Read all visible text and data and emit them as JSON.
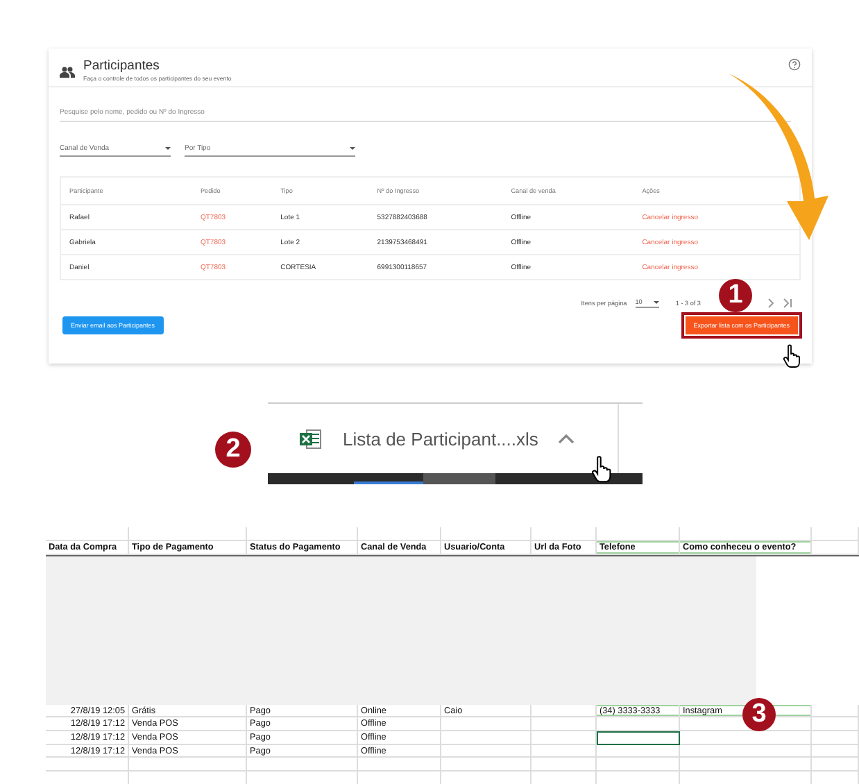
{
  "card": {
    "title": "Participantes",
    "subtitle": "Faça o controle de todos os participantes do seu evento",
    "search": {
      "placeholder": "Pesquise pelo nome, pedido ou Nº do Ingresso"
    },
    "filters": [
      {
        "placeholder": "Canal de Venda"
      },
      {
        "placeholder": "Por Tipo"
      }
    ],
    "table": {
      "columns": [
        "Participante",
        "Pedido",
        "Tipo",
        "Nº do Ingresso",
        "Canal de venda",
        "Ações"
      ],
      "rows": [
        [
          "Rafael",
          "QT7803",
          "Lote 1",
          "5327882403688",
          "Offline",
          "Cancelar ingresso"
        ],
        [
          "Gabriela",
          "QT7803",
          "Lote 2",
          "2139753468491",
          "Offline",
          "Cancelar ingresso"
        ],
        [
          "Daniel",
          "QT7803",
          "CORTESIA",
          "6991300118657",
          "Offline",
          "Cancelar ingresso"
        ]
      ]
    },
    "pagination": {
      "items_label": "Itens per página",
      "per_page": "10",
      "range": "1 - 3 of 3"
    },
    "email_button": "Enviar email aos Participantes",
    "export_button": "Exportar lista com os Participantes"
  },
  "steps": [
    "1",
    "2",
    "3"
  ],
  "download": {
    "filename": "Lista de Participant....xls"
  },
  "sheet": {
    "columns": [
      {
        "label": "Data da Compra",
        "highlighted": false
      },
      {
        "label": "Tipo de Pagamento",
        "highlighted": false
      },
      {
        "label": "Status do Pagamento",
        "highlighted": false
      },
      {
        "label": "Canal de Venda",
        "highlighted": false
      },
      {
        "label": "Usuario/Conta",
        "highlighted": false
      },
      {
        "label": "Url da Foto",
        "highlighted": false
      },
      {
        "label": "Telefone",
        "highlighted": true
      },
      {
        "label": "Como conheceu o evento?",
        "highlighted": true
      }
    ],
    "rows": [
      {
        "cells": [
          "27/8/19 12:05",
          "Grátis",
          "Pago",
          "Online",
          "Caio",
          "",
          "(34) 3333-3333",
          "Instagram"
        ],
        "highlighted": true,
        "selected_cells": [
          false,
          false,
          false,
          false,
          false,
          false,
          false,
          false
        ]
      },
      {
        "cells": [
          "12/8/19 17:12",
          "Venda POS",
          "Pago",
          "Offline",
          "",
          "",
          "",
          ""
        ],
        "highlighted": false,
        "selected_cells": [
          false,
          false,
          false,
          false,
          false,
          false,
          false,
          false
        ]
      },
      {
        "cells": [
          "12/8/19 17:12",
          "Venda POS",
          "Pago",
          "Offline",
          "",
          "",
          "",
          ""
        ],
        "highlighted": false,
        "selected_cells": [
          false,
          false,
          false,
          false,
          false,
          false,
          true,
          false
        ]
      },
      {
        "cells": [
          "12/8/19 17:12",
          "Venda POS",
          "Pago",
          "Offline",
          "",
          "",
          "",
          ""
        ],
        "highlighted": false,
        "selected_cells": [
          false,
          false,
          false,
          false,
          false,
          false,
          false,
          false
        ]
      }
    ]
  }
}
